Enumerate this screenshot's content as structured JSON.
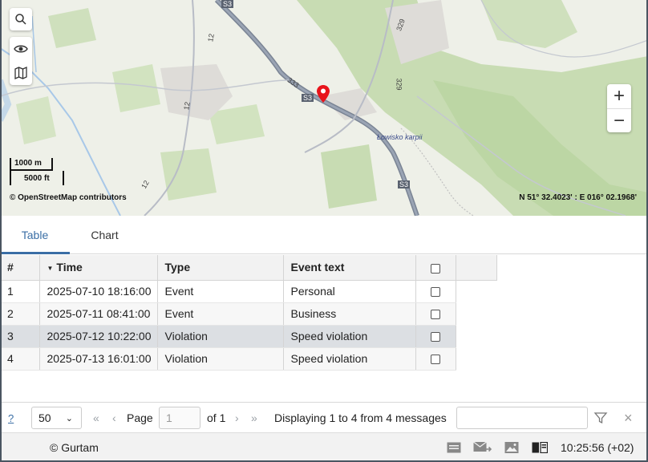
{
  "map": {
    "scale_metric": "1000 m",
    "scale_imperial": "5000 ft",
    "attribution": "© OpenStreetMap contributors",
    "coordinates": "N 51° 32.4023' : E 016° 02.1968'",
    "labels": {
      "road_s3_top": "S3",
      "road_s3_mid": "S3",
      "road_s3_bottom": "S3",
      "road_333": "333",
      "road_329_top": "329",
      "road_329_mid": "329",
      "road_12_top": "12",
      "road_12_mid": "12",
      "road_12_bottom": "12",
      "place": "Łowisko karpii"
    },
    "marker_color": "#e8141b",
    "controls": {
      "search_icon": "search-icon",
      "eye_icon": "eye-icon",
      "map_icon": "map-icon",
      "zoom_in": "+",
      "zoom_out": "−"
    }
  },
  "tabs": [
    {
      "label": "Table",
      "active": true
    },
    {
      "label": "Chart",
      "active": false
    }
  ],
  "table": {
    "columns": [
      "#",
      "Time",
      "Type",
      "Event text"
    ],
    "sorted_column": "Time",
    "rows": [
      {
        "num": "1",
        "time": "2025-07-10 18:16:00",
        "type": "Event",
        "text": "Personal"
      },
      {
        "num": "2",
        "time": "2025-07-11 08:41:00",
        "type": "Event",
        "text": "Business"
      },
      {
        "num": "3",
        "time": "2025-07-12 10:22:00",
        "type": "Violation",
        "text": "Speed violation"
      },
      {
        "num": "4",
        "time": "2025-07-13 16:01:00",
        "type": "Violation",
        "text": "Speed violation"
      }
    ]
  },
  "pager": {
    "help": "?",
    "page_size": "50",
    "page_label": "Page",
    "page_value": "1",
    "of_label": "of 1",
    "displaying": "Displaying 1 to 4 from 4 messages",
    "filter_icon": "filter-icon",
    "clear": "×"
  },
  "status": {
    "copyright": "© Gurtam",
    "time": "10:25:56 (+02)"
  },
  "colors": {
    "accent": "#3a6ea5",
    "frame": "#4a5561"
  }
}
